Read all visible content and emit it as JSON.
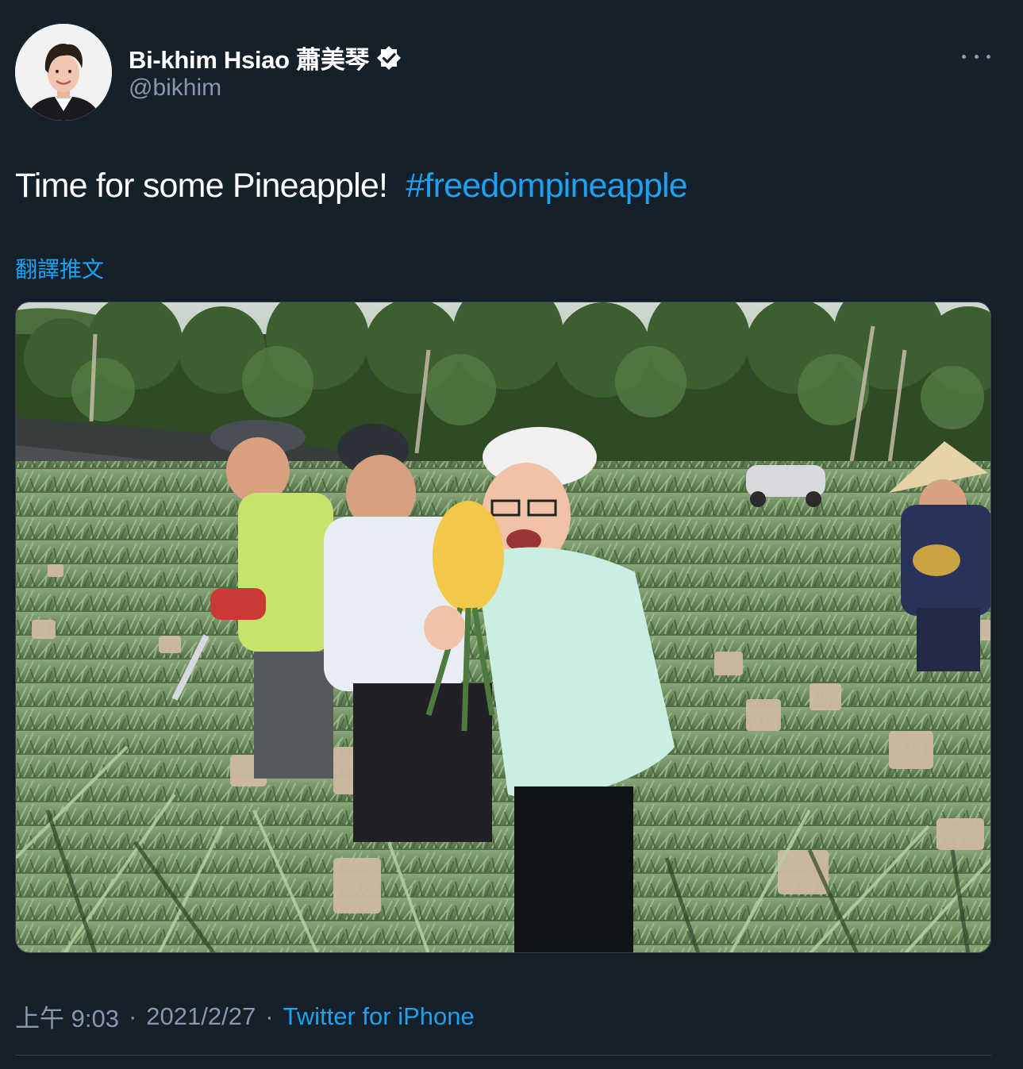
{
  "header": {
    "display_name": "Bi-khim Hsiao 蕭美琴",
    "handle": "@bikhim",
    "verified_icon": "verified-badge-icon",
    "more_icon": "more-options-icon"
  },
  "tweet": {
    "text": "Time for some Pineapple!",
    "hashtag": "#freedompineapple",
    "translate_label": "翻譯推文"
  },
  "media": {
    "type": "photo"
  },
  "meta": {
    "time": "上午 9:03",
    "separator": "·",
    "date": "2021/2/27",
    "source": "Twitter for iPhone"
  },
  "colors": {
    "background": "#15202b",
    "accent": "#1da1f2",
    "secondary_text": "#8899a6",
    "divider": "#38444d"
  }
}
